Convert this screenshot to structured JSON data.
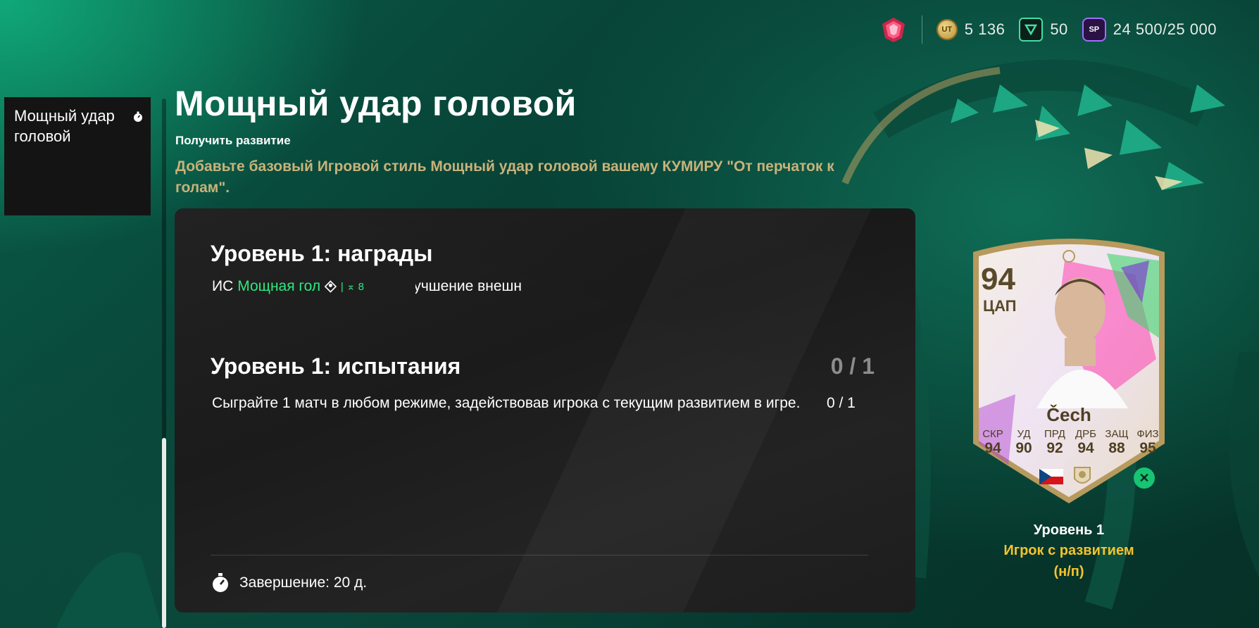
{
  "colors": {
    "accent_green": "#2ee87f",
    "gold_text": "#c9b27a",
    "status_yellow": "#f5c32b",
    "panel_bg": "#1e1e1e"
  },
  "topbar": {
    "currencies": [
      {
        "icon": "coin-icon",
        "abbr": "UT",
        "value": "5 136"
      },
      {
        "icon": "fc-points-icon",
        "abbr": "",
        "value": "50"
      },
      {
        "icon": "season-points-icon",
        "abbr": "SP",
        "value": "24 500/25 000"
      }
    ]
  },
  "sidebar": {
    "items": [
      {
        "label": "Мощный удар головой",
        "icon": "stopwatch-icon"
      }
    ]
  },
  "header": {
    "title": "Мощный удар головой",
    "subtitle": "Получить развитие",
    "description": "Добавьте базовый Игровой стиль Мощный удар головой вашему КУМИРУ \"От перчаток к голам\"."
  },
  "rewards": {
    "title": "Уровень 1: награды",
    "prefix": "ИС",
    "playstyle": "Мощная голо",
    "small": "| ⌅ 8",
    "tail": "лучшение внешн"
  },
  "challenges": {
    "title": "Уровень 1: испытания",
    "count": "0 / 1",
    "objectives": [
      {
        "text": "Сыграйте 1 матч в любом режиме, задействовав игрока с текущим развитием в игре.",
        "count": "0 / 1"
      }
    ]
  },
  "footer": {
    "timer_text": "Завершение: 20 д."
  },
  "card": {
    "rating": "94",
    "position": "ЦАП",
    "name": "Čech",
    "stats": [
      {
        "label": "СКР",
        "value": "94"
      },
      {
        "label": "УД",
        "value": "90"
      },
      {
        "label": "ПРД",
        "value": "92"
      },
      {
        "label": "ДРБ",
        "value": "94"
      },
      {
        "label": "ЗАЩ",
        "value": "88"
      },
      {
        "label": "ФИЗ",
        "value": "95"
      }
    ],
    "level": "Уровень 1",
    "status_line1": "Игрок с развитием",
    "status_line2": "(н/п)"
  }
}
